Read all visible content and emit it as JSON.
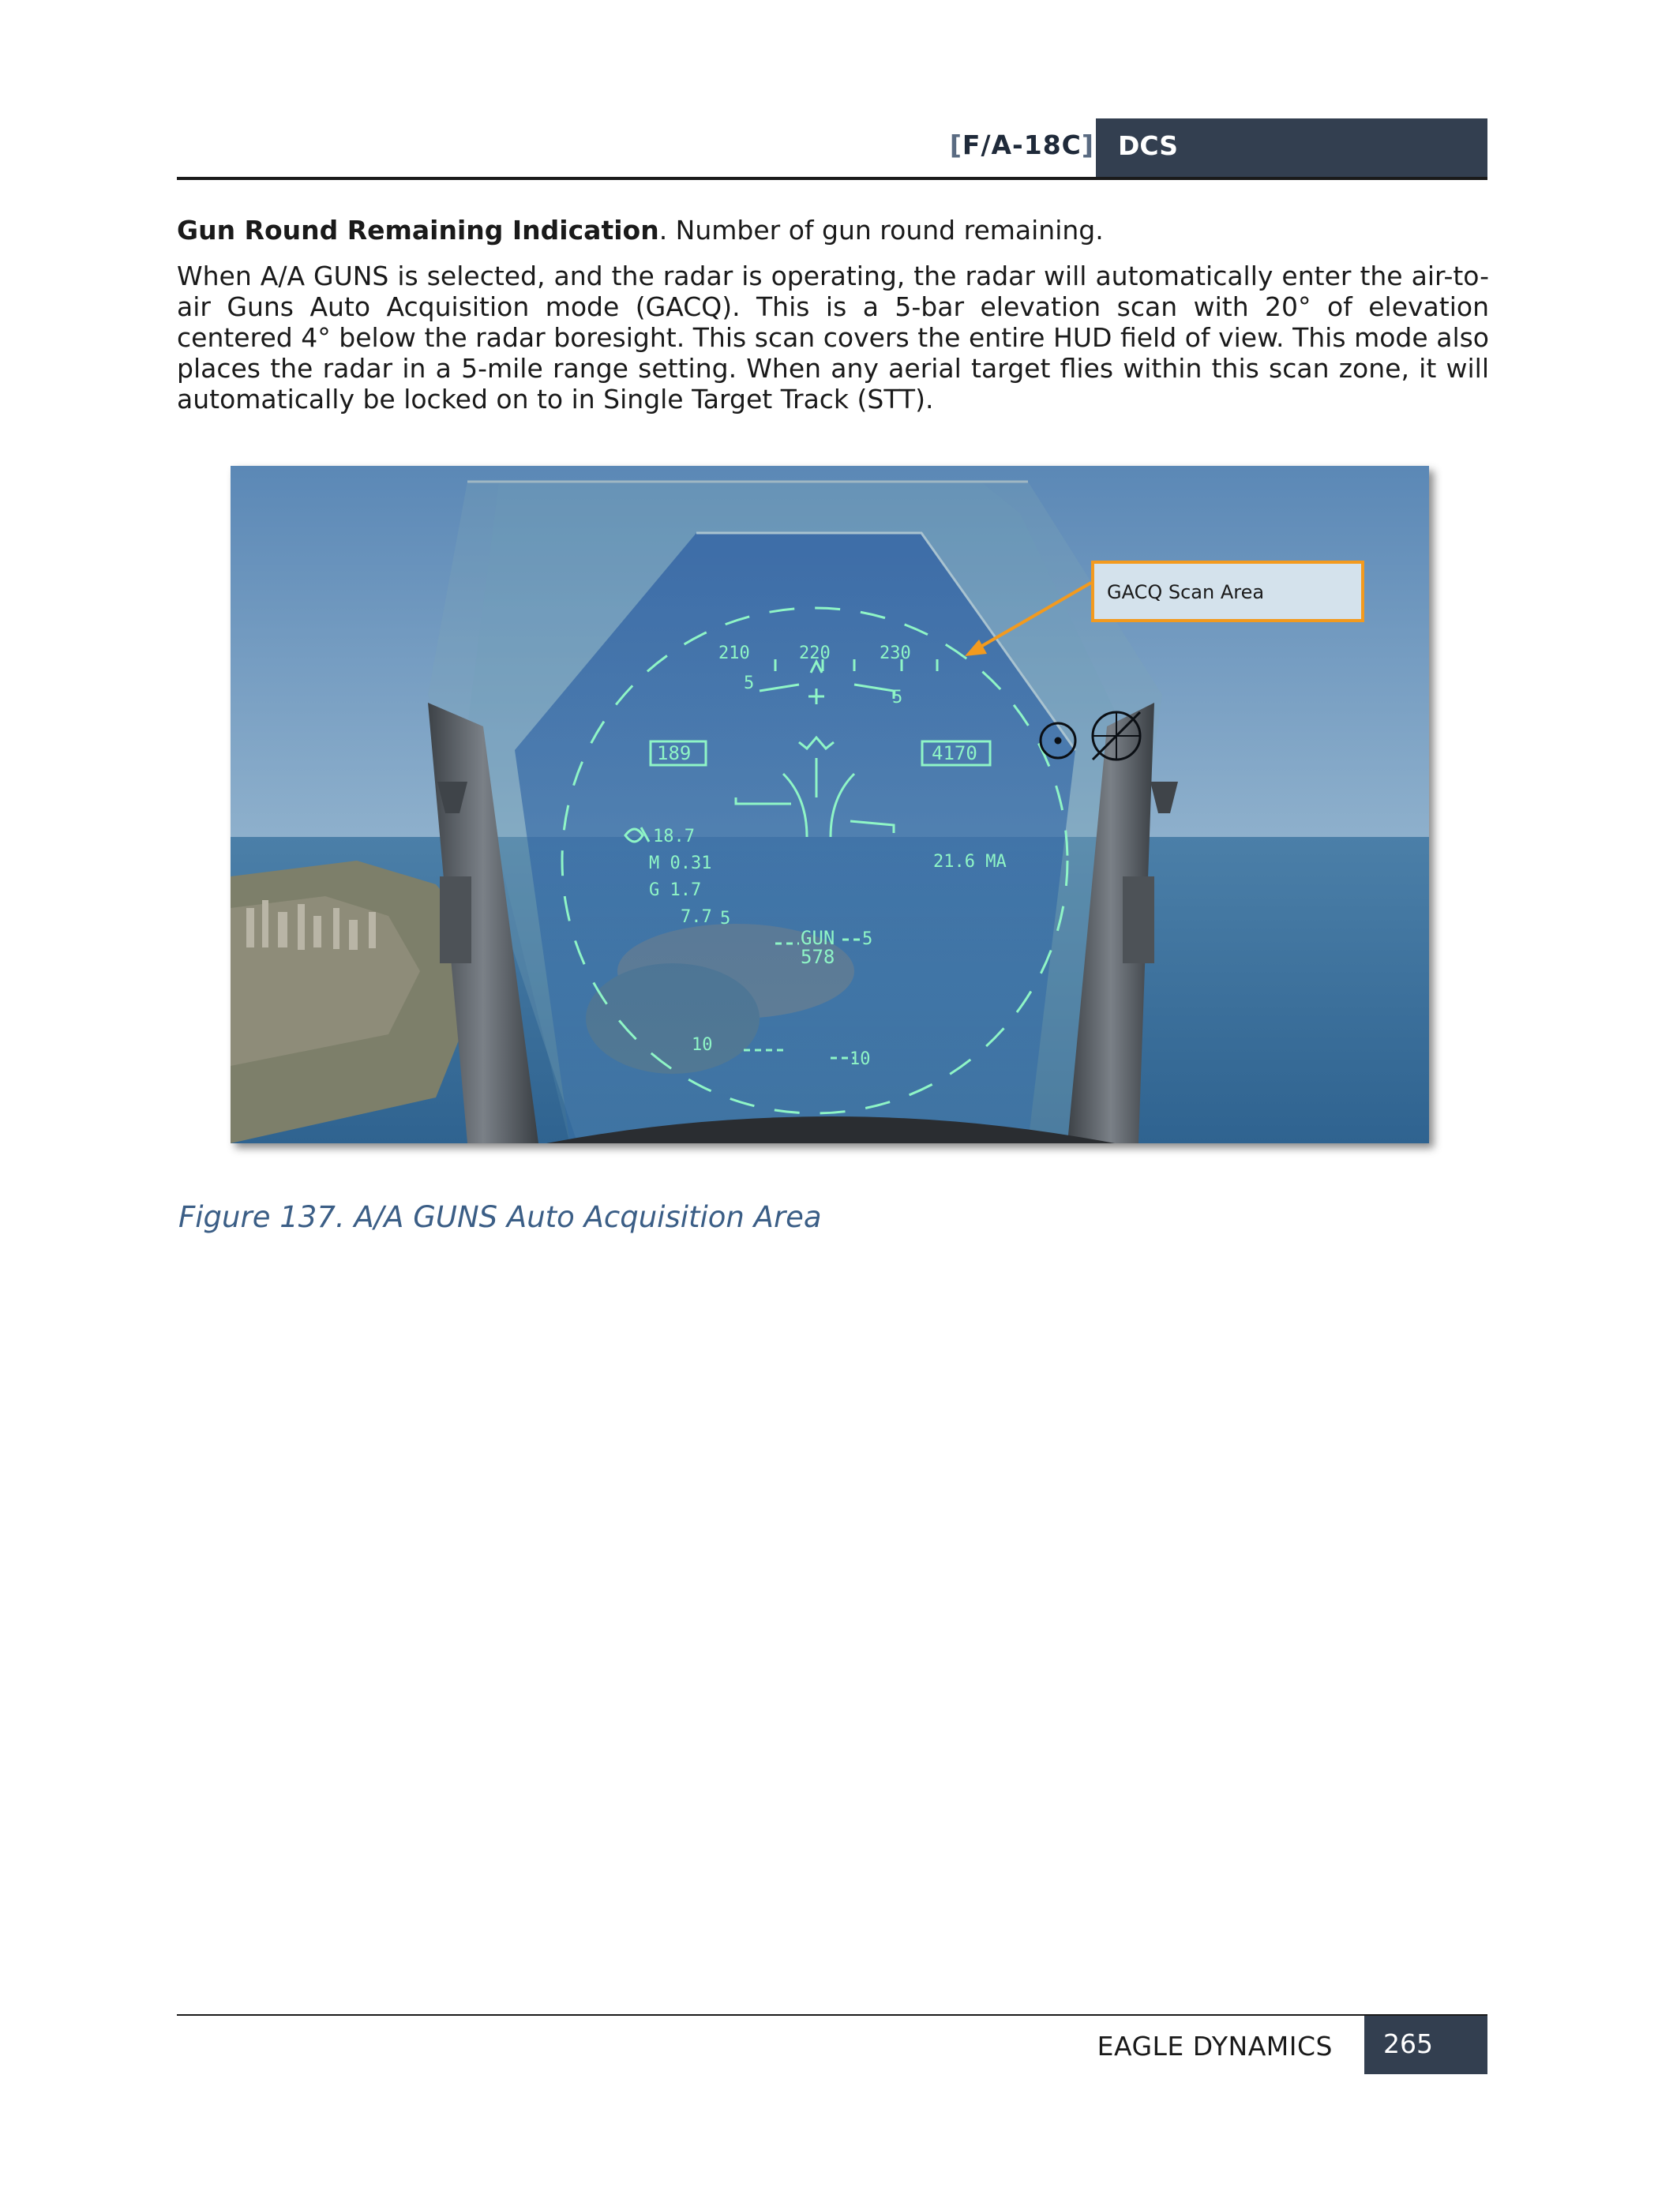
{
  "header": {
    "product_bracket_open": "[",
    "product": "F/A-18C",
    "product_bracket_close": "]",
    "badge": "DCS"
  },
  "paragraph1": {
    "bold": "Gun Round Remaining Indication",
    "rest": ". Number of gun round remaining."
  },
  "paragraph2": "When A/A GUNS is selected, and the radar is operating, the radar will automatically enter the air-to-air Guns Auto Acquisition mode (GACQ). This is a 5-bar elevation scan with 20° of elevation centered 4° below the radar boresight. This scan covers the entire HUD field of view. This mode also places the radar in a 5-mile range setting. When any aerial target flies within this scan zone, it will automatically be locked on to in Single Target Track (STT).",
  "figure": {
    "callout": "GACQ Scan Area",
    "hud": {
      "heading_ticks": [
        "210",
        "220",
        "230"
      ],
      "airspeed": "189",
      "altitude": "4170",
      "alpha": "18.7",
      "mach": "M  0.31",
      "g": "G  1.7",
      "peak_g": "7.7",
      "range": "21.6 MA",
      "gun_label": "GUN",
      "gun_rounds": "578",
      "pitch_upper_left": "5",
      "pitch_upper_right": "5",
      "pitch_mid_left": "5",
      "pitch_mid_right": "5",
      "pitch_lower_left": "10",
      "pitch_lower_right": "10"
    },
    "colors": {
      "hud_symbology": "#8ff5c6",
      "callout_border": "#f39a1e"
    }
  },
  "caption": "Figure 137. A/A GUNS Auto Acquisition Area",
  "footer": {
    "company": "EAGLE DYNAMICS",
    "page": "265"
  }
}
